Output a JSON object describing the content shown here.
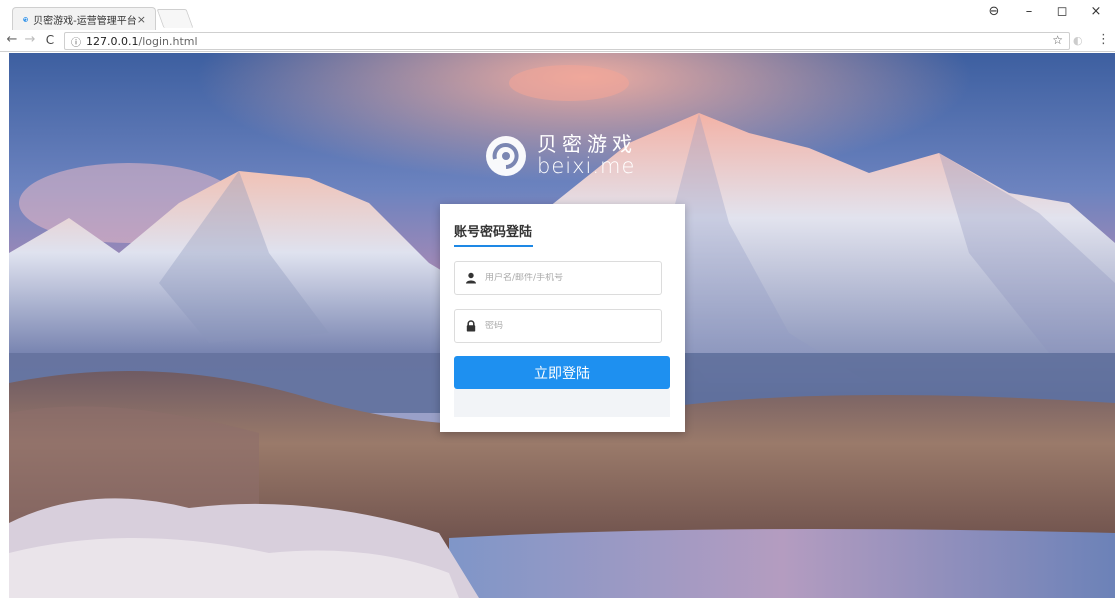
{
  "browser": {
    "tab_title": "贝密游戏-运营管理平台",
    "tab_close": "×",
    "url_host": "127.0.0.1",
    "url_path": "/login.html",
    "window_user": "⊖",
    "window_min": "–",
    "window_max": "◻",
    "window_close": "×",
    "nav_back": "←",
    "nav_forward": "→",
    "nav_reload": "C",
    "info_icon": "ⓘ",
    "star_icon": "☆",
    "menu_icon": "⋮"
  },
  "logo": {
    "name_cn": "贝密游戏",
    "name_en": "beixi.me"
  },
  "login": {
    "title": "账号密码登陆",
    "username_placeholder": "用户名/邮件/手机号",
    "password_placeholder": "密码",
    "submit_label": "立即登陆"
  },
  "colors": {
    "accent": "#1e90f0",
    "underline": "#1e88e5"
  }
}
